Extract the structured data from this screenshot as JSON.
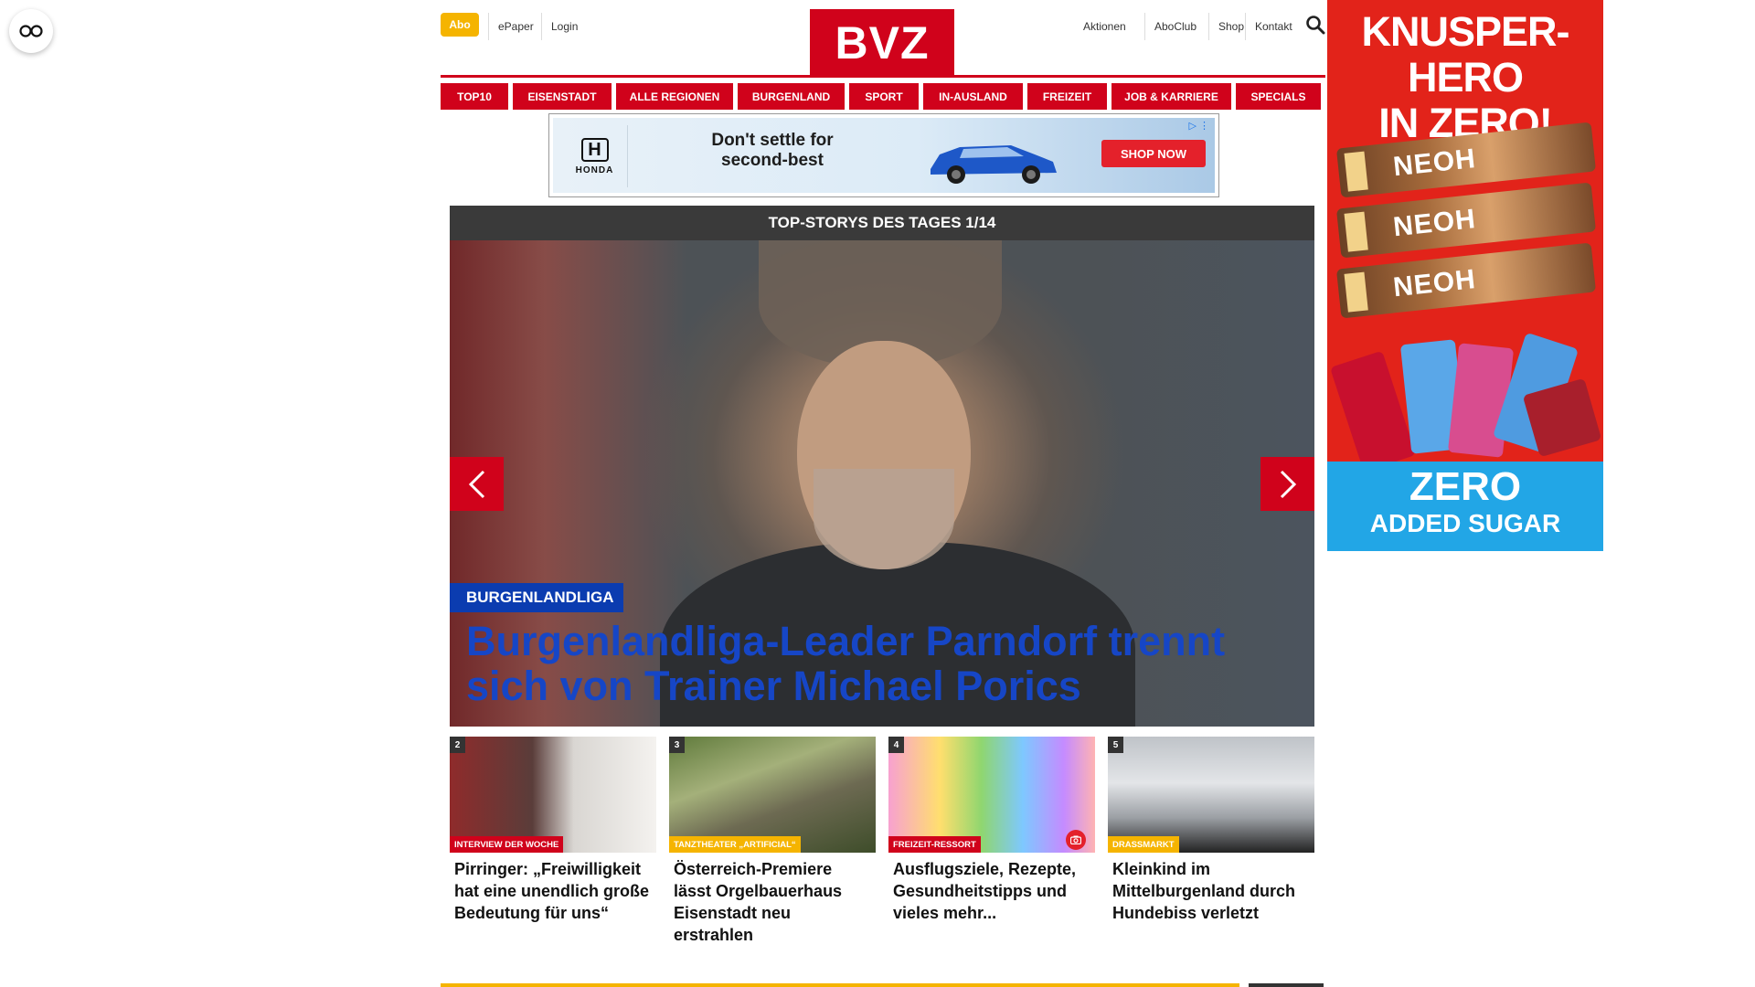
{
  "header": {
    "abo": "Abo",
    "links_left": [
      "ePaper",
      "Login"
    ],
    "logo": "BVZ",
    "links_right": [
      "Aktionen",
      "AboClub",
      "Shop",
      "Kontakt"
    ]
  },
  "nav": {
    "items": [
      "TOP10",
      "EISENSTADT",
      "ALLE REGIONEN",
      "BURGENLAND",
      "SPORT",
      "IN-AUSLAND",
      "FREIZEIT",
      "JOB & KARRIERE",
      "SPECIALS"
    ]
  },
  "ad_banner": {
    "brand": "HONDA",
    "headline": "Don't settle for second-best",
    "cta": "SHOP NOW"
  },
  "top_stories": {
    "header": "TOP-STORYS DES TAGES 1/14",
    "hero": {
      "category": "BURGENLANDLIGA",
      "title": "Burgenlandliga-Leader Parndorf trennt sich von Trainer Michael Porics"
    },
    "cards": [
      {
        "num": "2",
        "tag": "INTERVIEW DER WOCHE",
        "tag_color": "#d0021b",
        "title": "Pirringer: „Freiwilligkeit hat eine unendlich große Bedeutung für uns“"
      },
      {
        "num": "3",
        "tag": "TANZTHEATER „ARTIFICIAL“",
        "tag_color": "#f5b400",
        "title": "Österreich-Premiere lässt Orgelbauerhaus Eisenstadt neu erstrahlen"
      },
      {
        "num": "4",
        "tag": "FREIZEIT-RESSORT",
        "tag_color": "#d0021b",
        "title": "Ausflugsziele, Rezepte, Gesundheitstipps und vieles mehr..."
      },
      {
        "num": "5",
        "tag": "DRASSMARKT",
        "tag_color": "#f5b400",
        "title": "Kleinkind im Mittelburgenland durch Hundebiss verletzt"
      }
    ]
  },
  "skyscraper_ad": {
    "headline_line1": "KNUSPER-HERO",
    "headline_line2": "IN ZERO!",
    "bar_label": "NEOH",
    "footer_line1": "ZERO",
    "footer_line2": "ADDED SUGAR"
  },
  "colors": {
    "brand_red": "#d0021b",
    "accent_yellow": "#f5b400",
    "hero_blue": "#1646c6"
  }
}
